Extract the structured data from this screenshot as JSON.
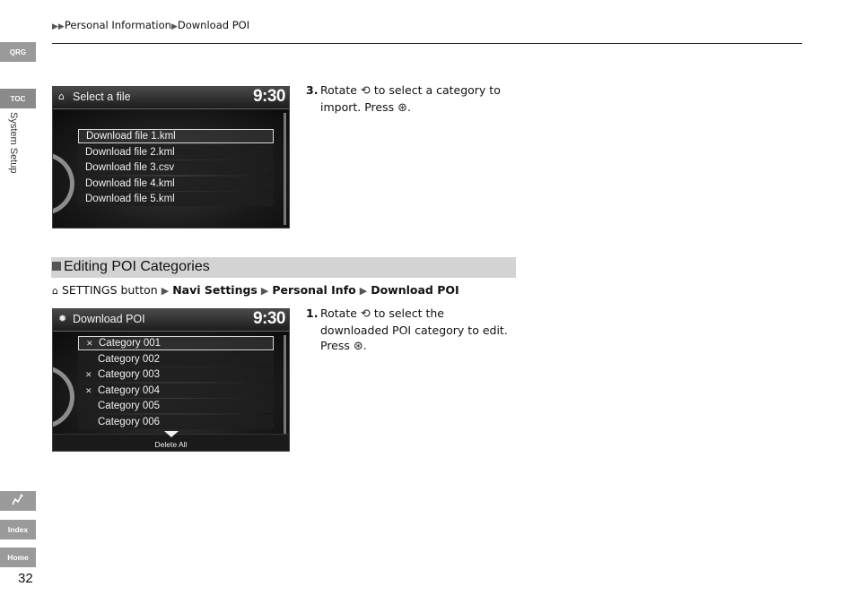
{
  "breadcrumb": {
    "items": [
      "Personal Information",
      "Download POI"
    ]
  },
  "sidebar": {
    "qrg": "QRG",
    "toc": "TOC",
    "section": "System Setup",
    "index": "Index",
    "home": "Home",
    "voice_icon": "voice-command-icon"
  },
  "page_number": "32",
  "screen1": {
    "title": "Select a file",
    "clock": "9:30",
    "items": [
      "Download file 1.kml",
      "Download file 2.kml",
      "Download file 3.csv",
      "Download file 4.kml",
      "Download file 5.kml"
    ]
  },
  "step3": {
    "number": "3.",
    "text_before": "Rotate",
    "text_middle": "to select a category to import. Press",
    "text_after": "."
  },
  "section": {
    "title": "Editing POI Categories"
  },
  "path": {
    "start": "SETTINGS button",
    "items": [
      "Navi Settings",
      "Personal Info",
      "Download POI"
    ]
  },
  "screen2": {
    "title": "Download POI",
    "clock": "9:30",
    "items": [
      "Category 001",
      "Category 002",
      "Category 003",
      "Category 004",
      "Category 005",
      "Category 006"
    ],
    "checked": [
      true,
      false,
      true,
      true,
      false,
      false
    ],
    "footer": "Delete All"
  },
  "step1": {
    "number": "1.",
    "text_before": "Rotate",
    "text_middle": "to select the downloaded POI category to edit. Press",
    "text_after": "."
  }
}
